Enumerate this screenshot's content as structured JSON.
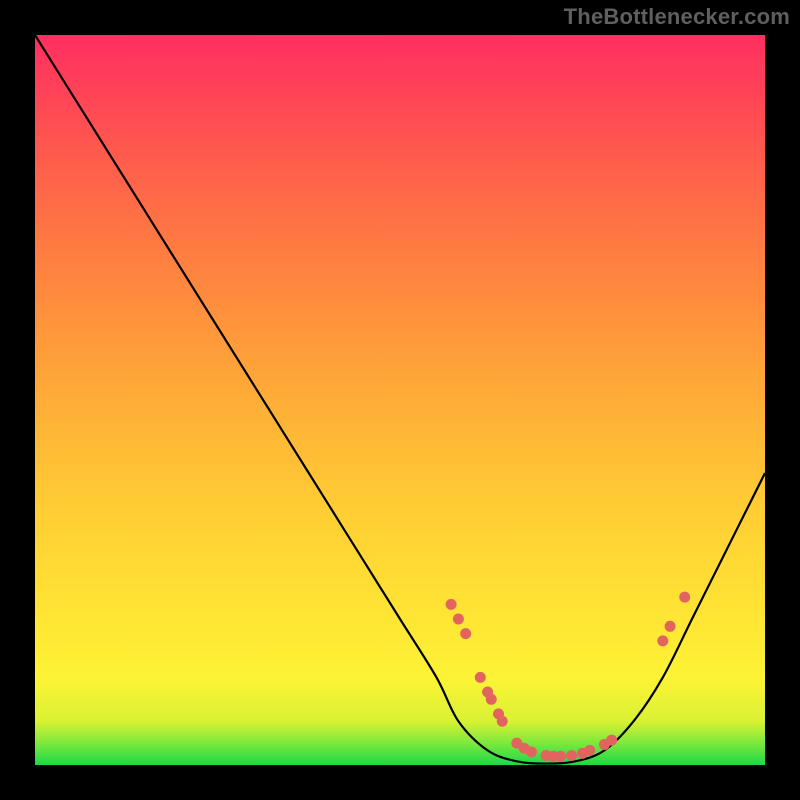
{
  "attribution": "TheBottlenecker.com",
  "colors": {
    "marker": "#e2645f",
    "curve": "#000000",
    "background_top": "#ff2f60",
    "background_bottom": "#1bd94a"
  },
  "chart_data": {
    "type": "line",
    "title": "",
    "xlabel": "",
    "ylabel": "",
    "xlim": [
      0,
      100
    ],
    "ylim": [
      0,
      100
    ],
    "grid": false,
    "series": [
      {
        "name": "bottleneck-curve",
        "x": [
          0,
          5,
          10,
          15,
          20,
          25,
          30,
          35,
          40,
          45,
          50,
          55,
          58,
          62,
          66,
          70,
          74,
          78,
          82,
          86,
          90,
          94,
          98,
          100
        ],
        "y": [
          100,
          92,
          84,
          76,
          68,
          60,
          52,
          44,
          36,
          28,
          20,
          12,
          6,
          2,
          0.5,
          0.2,
          0.5,
          2,
          6,
          12,
          20,
          28,
          36,
          40
        ]
      }
    ],
    "markers": [
      {
        "x": 57,
        "y": 22
      },
      {
        "x": 58,
        "y": 20
      },
      {
        "x": 59,
        "y": 18
      },
      {
        "x": 61,
        "y": 12
      },
      {
        "x": 62,
        "y": 10
      },
      {
        "x": 62.5,
        "y": 9
      },
      {
        "x": 63.5,
        "y": 7
      },
      {
        "x": 64,
        "y": 6
      },
      {
        "x": 66,
        "y": 3
      },
      {
        "x": 67,
        "y": 2.3
      },
      {
        "x": 68,
        "y": 1.8
      },
      {
        "x": 70,
        "y": 1.3
      },
      {
        "x": 71,
        "y": 1.2
      },
      {
        "x": 72,
        "y": 1.2
      },
      {
        "x": 73.5,
        "y": 1.3
      },
      {
        "x": 75,
        "y": 1.6
      },
      {
        "x": 76,
        "y": 2.0
      },
      {
        "x": 78,
        "y": 2.8
      },
      {
        "x": 79,
        "y": 3.4
      },
      {
        "x": 86,
        "y": 17
      },
      {
        "x": 87,
        "y": 19
      },
      {
        "x": 89,
        "y": 23
      }
    ]
  }
}
